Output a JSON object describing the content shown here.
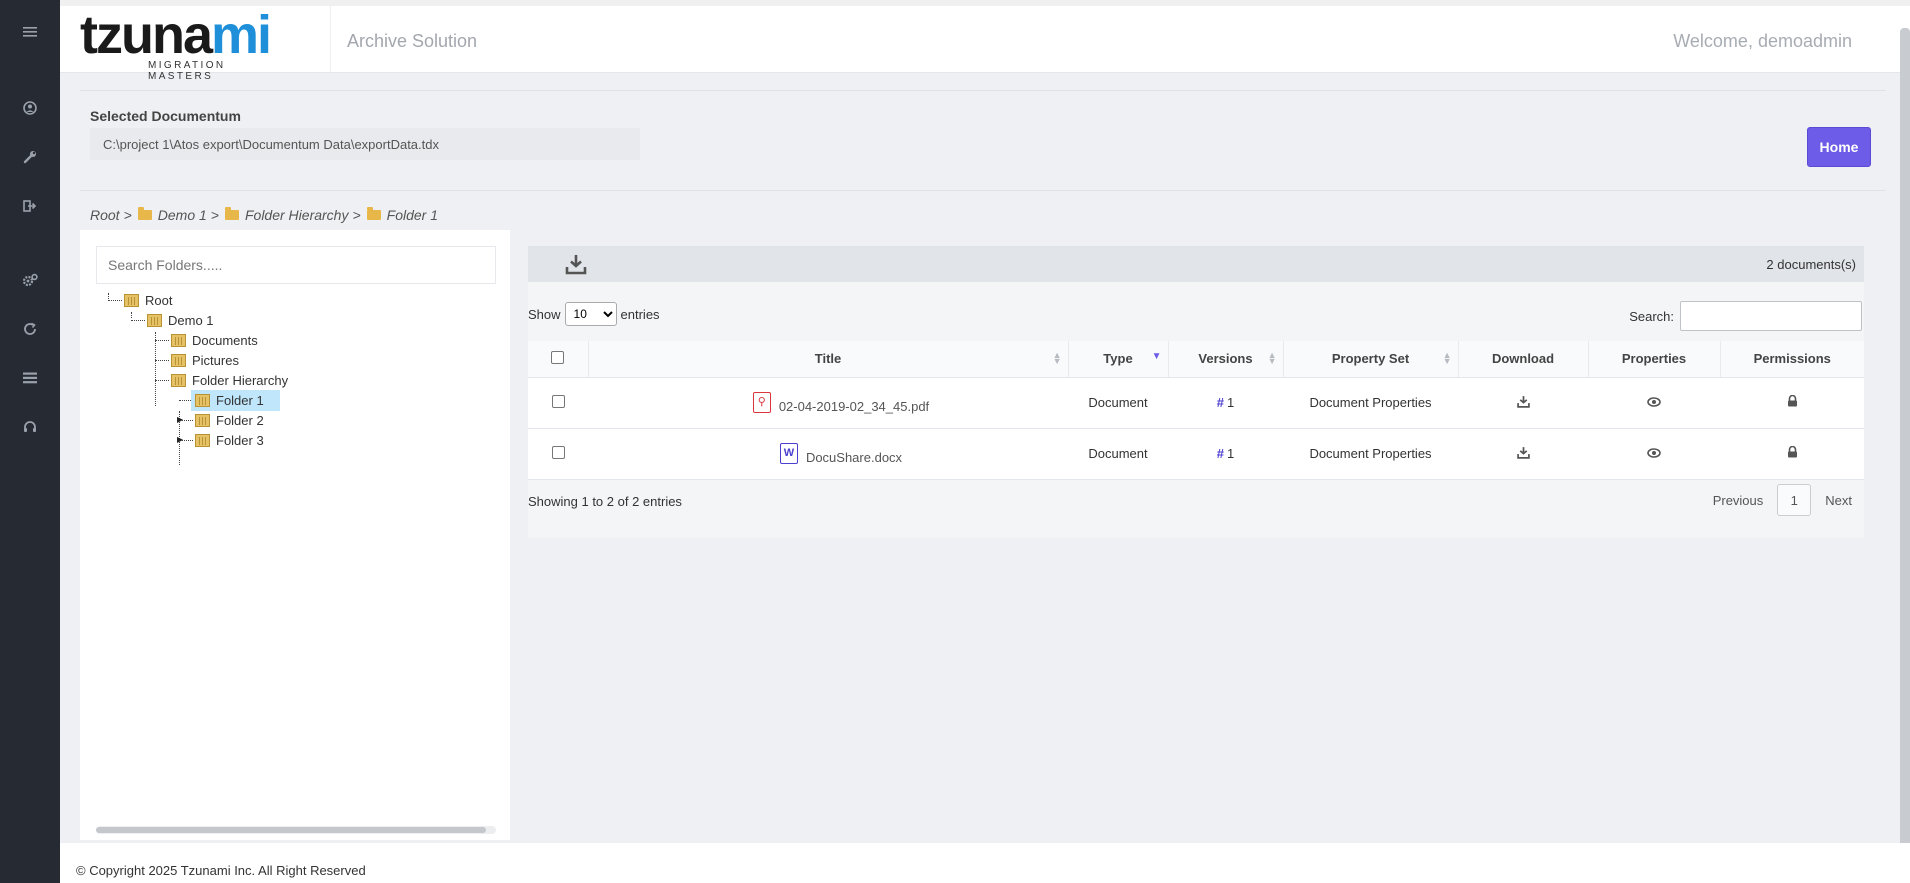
{
  "sidebar": {
    "icons": [
      {
        "name": "menu-icon",
        "glyph": "≡"
      },
      {
        "name": "user-icon",
        "glyph": "●"
      },
      {
        "name": "wrench-icon",
        "glyph": "✎"
      },
      {
        "name": "sign-out-icon",
        "glyph": "➔"
      },
      {
        "name": "cogs-icon",
        "glyph": "⚙"
      },
      {
        "name": "refresh-icon",
        "glyph": "↻"
      },
      {
        "name": "list-icon",
        "glyph": "☰"
      },
      {
        "name": "headset-icon",
        "glyph": "◠"
      }
    ]
  },
  "header": {
    "logo_main_a": "tzuna",
    "logo_main_b": "mi",
    "logo_sub": "MIGRATION MASTERS",
    "app_title": "Archive Solution",
    "welcome": "Welcome, demoadmin",
    "logo_accent": "#1e8fd8"
  },
  "selected": {
    "label": "Selected Documentum",
    "path": "C:\\project 1\\Atos export\\Documentum Data\\exportData.tdx",
    "home_label": "Home",
    "accent": "#6c5ce7"
  },
  "breadcrumb": {
    "root": "Root",
    "sep": ">",
    "items": [
      "Demo 1",
      "Folder Hierarchy",
      "Folder 1"
    ]
  },
  "tree": {
    "search_placeholder": "Search Folders.....",
    "nodes": {
      "root": "Root",
      "demo1": "Demo 1",
      "documents": "Documents",
      "pictures": "Pictures",
      "folder_hierarchy": "Folder Hierarchy",
      "folder1": "Folder 1",
      "folder2": "Folder 2",
      "folder3": "Folder 3"
    }
  },
  "docs": {
    "count": "2 documents(s)",
    "show_label": "Show",
    "entries_label": "entries",
    "page_size": "10",
    "search_label": "Search:",
    "columns": {
      "title": "Title",
      "type": "Type",
      "versions": "Versions",
      "property_set": "Property Set",
      "download": "Download",
      "properties": "Properties",
      "permissions": "Permissions"
    },
    "rows": [
      {
        "file_type": "pdf",
        "title": "02-04-2019-02_34_45.pdf",
        "type": "Document",
        "versions": "1",
        "property_set": "Document Properties"
      },
      {
        "file_type": "docx",
        "title": "DocuShare.docx",
        "type": "Document",
        "versions": "1",
        "property_set": "Document Properties"
      }
    ],
    "showing": "Showing 1 to 2 of 2 entries",
    "previous": "Previous",
    "page": "1",
    "next": "Next"
  },
  "footer": {
    "copyright": "© Copyright 2025 Tzunami Inc. All Right Reserved"
  }
}
